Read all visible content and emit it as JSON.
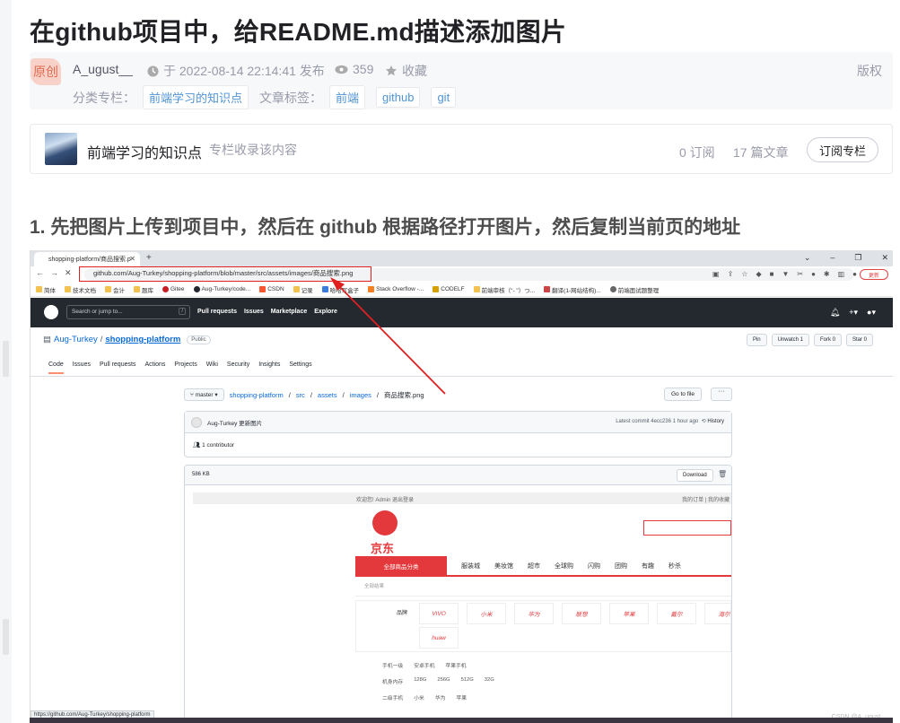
{
  "article": {
    "title": "在github项目中，给README.md描述添加图片",
    "badge": "原创",
    "author": "A_ugust__",
    "time_icon": "clock-icon",
    "publish_time": "于 2022-08-14 22:14:41 发布",
    "views": "359",
    "collect_label": "收藏",
    "copyright": "版权",
    "category_label": "分类专栏：",
    "category": "前端学习的知识点",
    "tags_label": "文章标签：",
    "tags": [
      "前端",
      "github",
      "git"
    ]
  },
  "column": {
    "name": "前端学习的知识点",
    "desc": "专栏收录该内容",
    "subscriptions": "0 订阅",
    "articles": "17 篇文章",
    "subscribe_button": "订阅专栏"
  },
  "step1": "1. 先把图片上传到项目中，然后在 github 根据路径打开图片，然后复制当前页的地址",
  "screenshot": {
    "tab_title": "shopping-platform/商品搜索.p",
    "address": "github.com/Aug-Turkey/shopping-platform/blob/master/src/assets/images/商品搜索.png",
    "update_label": "更新",
    "bookmarks": [
      "简体",
      "技术文档",
      "会计",
      "题库",
      "Gitee",
      "Aug-Turkey/code...",
      "CSDN",
      "记录",
      "哈哈写盒子",
      "Stack Overflow -...",
      "CODELF",
      "前端审核（\"- \"）つ...",
      "翻译(1-网站结构)...",
      "前端面试题整理"
    ],
    "gh_search": "Search or jump to...",
    "gh_nav": [
      "Pull requests",
      "Issues",
      "Marketplace",
      "Explore"
    ],
    "repo_owner": "Aug-Turkey",
    "repo_name": "shopping-platform",
    "repo_visibility": "Public",
    "repo_buttons": [
      "Pin",
      "Unwatch 1",
      "Fork 0",
      "Star 0"
    ],
    "repo_tabs": [
      "Code",
      "Issues",
      "Pull requests",
      "Actions",
      "Projects",
      "Wiki",
      "Security",
      "Insights",
      "Settings"
    ],
    "branch": "master",
    "breadcrumb": [
      "shopping-platform",
      "src",
      "assets",
      "images",
      "商品搜索.png"
    ],
    "go_to_file": "Go to file",
    "commit_author": "Aug-Turkey 更新图片",
    "commit_meta": "Latest commit 4ecc236 1 hour ago",
    "history": "History",
    "contributors": "1 contributor",
    "file_size": "586 KB",
    "download": "Download",
    "jd_top_left": "欢迎您!   Admin   退出登录",
    "jd_top_right": "我的订单  |  我的收藏",
    "jd_logo_text": "京东",
    "jd_category": "全部商品分类",
    "jd_nav": [
      "服装城",
      "美妆馆",
      "超市",
      "全球购",
      "闪购",
      "团购",
      "有趣",
      "秒杀"
    ],
    "jd_all": "全部结果",
    "jd_brand_label": "品牌",
    "jd_brands": [
      "VIVO",
      "小米",
      "华为",
      "联想",
      "苹果",
      "戴尔",
      "海尔",
      "huaw"
    ],
    "jd_specs": [
      [
        "手机一级",
        "安卓手机",
        "苹果手机"
      ],
      [
        "机身内存",
        "128G",
        "256G",
        "512G",
        "32G"
      ],
      [
        "二级手机",
        "小米",
        "华为",
        "苹果"
      ]
    ],
    "status_url": "https://github.com/Aug-Turkey/shopping-platform",
    "watermark": "CSDN @A_ugust__"
  }
}
